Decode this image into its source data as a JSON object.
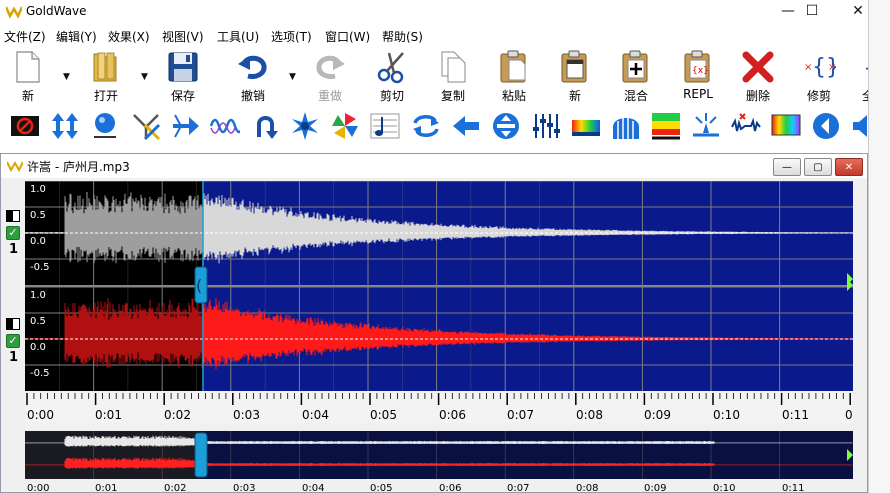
{
  "app": {
    "title": "GoldWave",
    "window_controls": {
      "minimize": "—",
      "maximize": "☐",
      "close": "✕"
    }
  },
  "menu": [
    {
      "label": "文件(Z)"
    },
    {
      "label": "编辑(Y)"
    },
    {
      "label": "效果(X)"
    },
    {
      "label": "视图(V)"
    },
    {
      "label": "工具(U)"
    },
    {
      "label": "选项(T)"
    },
    {
      "label": "窗口(W)"
    },
    {
      "label": "帮助(S)"
    }
  ],
  "toolbar": {
    "buttons": [
      {
        "label": "新",
        "icon": "new-file-icon"
      },
      {
        "label": "打开",
        "icon": "open-folder-icon"
      },
      {
        "label": "保存",
        "icon": "save-disk-icon"
      },
      {
        "label": "撤销",
        "icon": "undo-icon"
      },
      {
        "label": "重做",
        "icon": "redo-icon",
        "disabled": true
      },
      {
        "label": "剪切",
        "icon": "scissors-icon"
      },
      {
        "label": "复制",
        "icon": "copy-icon"
      },
      {
        "label": "粘贴",
        "icon": "paste-icon"
      },
      {
        "label": "新",
        "icon": "paste-new-icon"
      },
      {
        "label": "混合",
        "icon": "mix-icon"
      },
      {
        "label": "REPL",
        "icon": "replace-icon"
      },
      {
        "label": "删除",
        "icon": "delete-icon"
      },
      {
        "label": "修剪",
        "icon": "trim-icon"
      },
      {
        "label": "全部",
        "icon": "select-all-icon"
      }
    ]
  },
  "effects_toolbar": {
    "icons": [
      "stop-icon",
      "vertical-arrows-icon",
      "ball-icon",
      "crossfade-icon",
      "merge-arrow-icon",
      "wave-icon",
      "loop-icon",
      "gear-star-icon",
      "pinwheel-icon",
      "music-note-icon",
      "swap-arrows-icon",
      "left-arrow-icon",
      "compress-icon",
      "mixer-sliders-icon",
      "spectrum-bar-icon",
      "arch-filter-icon",
      "equalizer-icon",
      "splash-icon",
      "noise-reduction-icon",
      "rainbow-icon",
      "speaker-icon",
      "volume-icon"
    ]
  },
  "sound_window": {
    "title": "许嵩 - 庐州月.mp3",
    "buttons": {
      "minimize": "—",
      "restore": "▢",
      "close": "✕"
    },
    "channels": [
      {
        "number": "1",
        "color": "#d8d8d8",
        "yticks": [
          "1.0",
          "0.5",
          "0.0",
          "-0.5"
        ]
      },
      {
        "number": "",
        "color": "#ff1a1a",
        "yticks": [
          "1.0",
          "0.5",
          "0.0",
          "-0.5"
        ]
      }
    ],
    "timeline": [
      "0:00",
      "0:01",
      "0:02",
      "0:03",
      "0:04",
      "0:05",
      "0:06",
      "0:07",
      "0:08",
      "0:09",
      "0:10",
      "0:11",
      "0"
    ],
    "overview_timeline": [
      "0:00",
      "0:01",
      "0:02",
      "0:03",
      "0:04",
      "0:05",
      "0:06",
      "0:07",
      "0:08",
      "0:09",
      "0:10",
      "0:11"
    ],
    "selection_end_fraction": 0.215,
    "colors": {
      "unselected_bg": "#000000",
      "selected_bg": "#0a1a8c",
      "grid": "#7f7f7f",
      "cursor": "#1c9fd8"
    }
  }
}
